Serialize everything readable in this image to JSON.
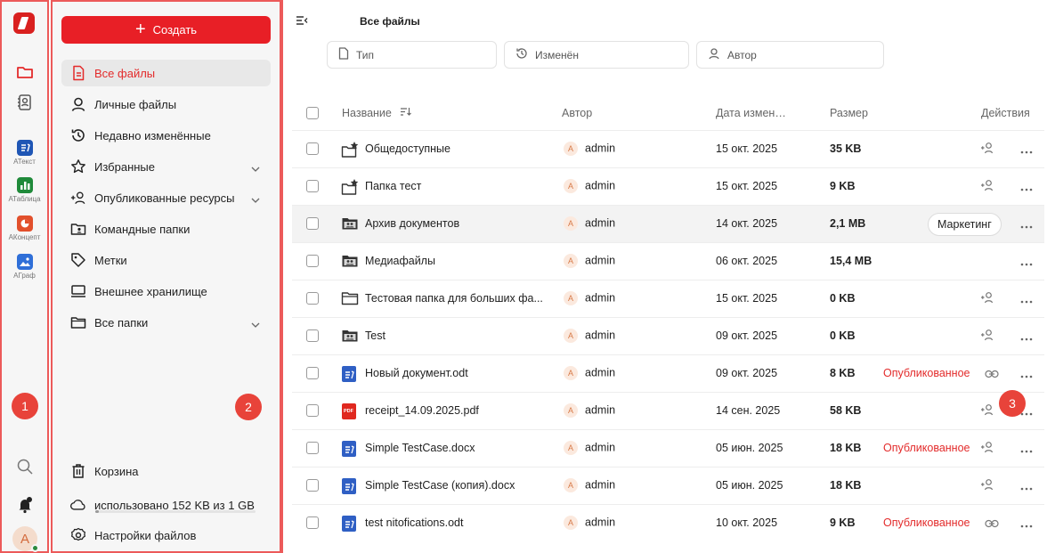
{
  "rail": {
    "apps": [
      {
        "label": "АТекст",
        "color": "#1f56b5",
        "glyph": "text-doc-icon"
      },
      {
        "label": "АТаблица",
        "color": "#1f8a3a",
        "glyph": "table-icon"
      },
      {
        "label": "АКонцепт",
        "color": "#e2502c",
        "glyph": "presentation-icon"
      },
      {
        "label": "АГраф",
        "color": "#2f6fd8",
        "glyph": "image-icon"
      }
    ],
    "marker_1": "1",
    "avatar_letter": "A"
  },
  "sidebar": {
    "create_label": "Создать",
    "items": [
      {
        "label": "Все файлы",
        "icon": "all-files-icon",
        "active": true
      },
      {
        "label": "Личные файлы",
        "icon": "user-icon"
      },
      {
        "label": "Недавно изменённые",
        "icon": "history-icon"
      },
      {
        "label": "Избранные",
        "icon": "star-icon",
        "chevron": true
      },
      {
        "label": "Опубликованные ресурсы",
        "icon": "share-user-icon",
        "chevron": true
      },
      {
        "label": "Командные папки",
        "icon": "team-folder-icon"
      },
      {
        "label": "Метки",
        "icon": "tag-icon"
      },
      {
        "label": "Внешнее хранилище",
        "icon": "external-storage-icon"
      },
      {
        "label": "Все папки",
        "icon": "folder-icon",
        "chevron": true
      }
    ],
    "marker_2": "2",
    "trash_label": "Корзина",
    "storage_label": "использовано 152 KB из 1 GB",
    "storage_fraction": 0.0001,
    "settings_label": "Настройки файлов"
  },
  "main": {
    "title": "Все файлы",
    "filters": {
      "type": "Тип",
      "modified": "Изменён",
      "author": "Автор"
    },
    "columns": {
      "name": "Название",
      "author": "Автор",
      "date": "Дата измен…",
      "size": "Размер",
      "actions": "Действия"
    },
    "marker_3": "3",
    "rows": [
      {
        "name": "Общедоступные",
        "icon": "folder-star",
        "author": "admin",
        "date": "15 окт. 2025",
        "size": "35 KB",
        "status": "",
        "tag": "",
        "action": "share"
      },
      {
        "name": "Папка тест",
        "icon": "folder-star",
        "author": "admin",
        "date": "15 окт. 2025",
        "size": "9 KB",
        "status": "",
        "tag": "",
        "action": "share"
      },
      {
        "name": "Архив документов",
        "icon": "team-folder",
        "author": "admin",
        "date": "14 окт. 2025",
        "size": "2,1 MB",
        "status": "",
        "tag": "Маркетинг",
        "action": "",
        "highlight": true
      },
      {
        "name": "Медиафайлы",
        "icon": "team-folder",
        "author": "admin",
        "date": "06 окт. 2025",
        "size": "15,4 MB",
        "status": "",
        "tag": "",
        "action": ""
      },
      {
        "name": "Тестовая папка для больших фа...",
        "icon": "folder",
        "author": "admin",
        "date": "15 окт. 2025",
        "size": "0 KB",
        "status": "",
        "tag": "",
        "action": "share"
      },
      {
        "name": "Test",
        "icon": "team-folder",
        "author": "admin",
        "date": "09 окт. 2025",
        "size": "0 KB",
        "status": "",
        "tag": "",
        "action": "share"
      },
      {
        "name": "Новый документ.odt",
        "icon": "doc",
        "author": "admin",
        "date": "09 окт. 2025",
        "size": "8 KB",
        "status": "Опубликованное",
        "tag": "",
        "action": "link"
      },
      {
        "name": "receipt_14.09.2025.pdf",
        "icon": "pdf",
        "author": "admin",
        "date": "14 сен. 2025",
        "size": "58 KB",
        "status": "",
        "tag": "",
        "action": "share"
      },
      {
        "name": "Simple TestCase.docx",
        "icon": "doc",
        "author": "admin",
        "date": "05 июн. 2025",
        "size": "18 KB",
        "status": "Опубликованное",
        "tag": "",
        "action": "share"
      },
      {
        "name": "Simple TestCase (копия).docx",
        "icon": "doc",
        "author": "admin",
        "date": "05 июн. 2025",
        "size": "18 KB",
        "status": "",
        "tag": "",
        "action": "share"
      },
      {
        "name": "test nitofications.odt",
        "icon": "doc",
        "author": "admin",
        "date": "10 окт. 2025",
        "size": "9 KB",
        "status": "Опубликованное",
        "tag": "",
        "action": "link"
      }
    ],
    "author_initial": "A",
    "pdf_badge": "PDF"
  }
}
